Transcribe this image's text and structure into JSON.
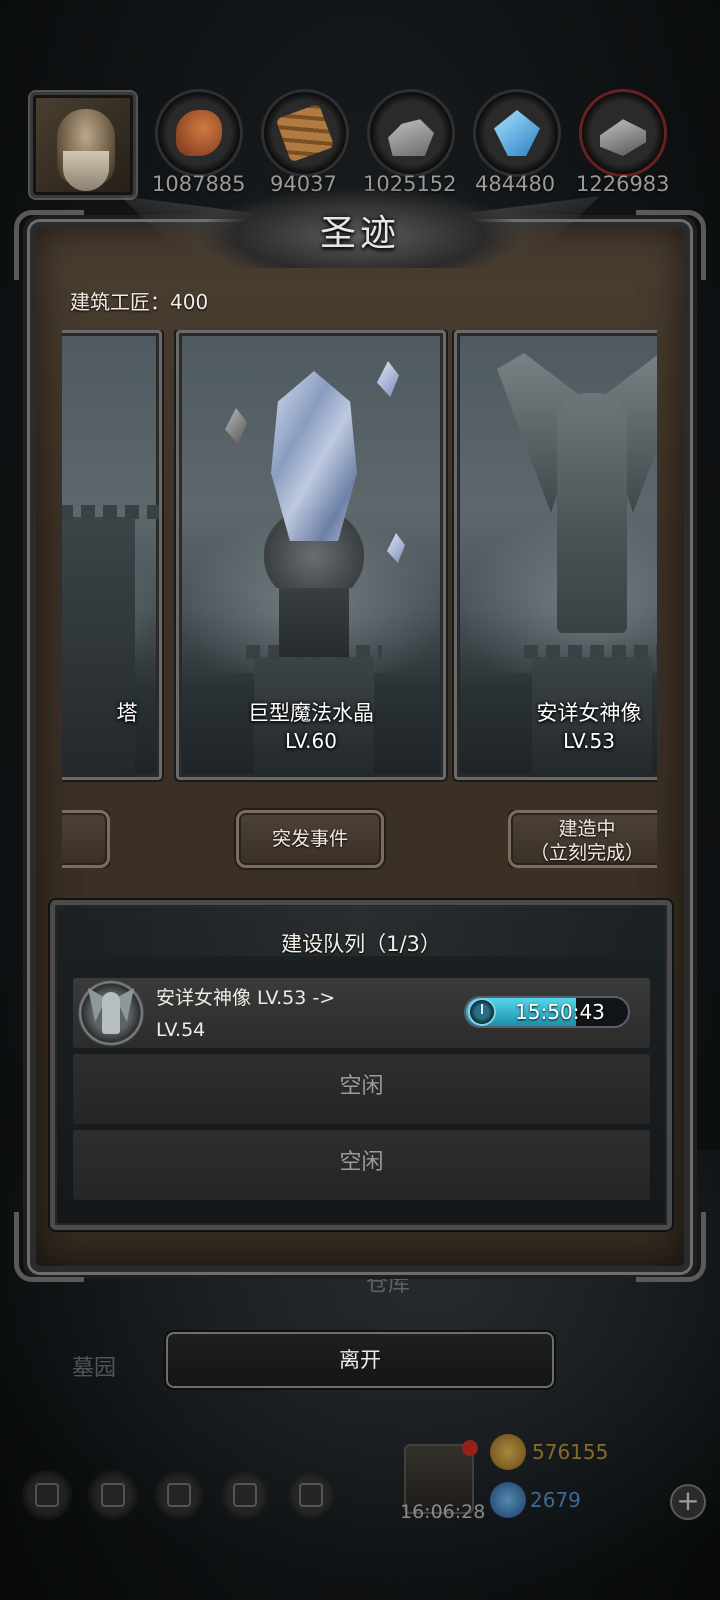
{
  "resources": [
    {
      "name": "meat-icon",
      "value": "1087885",
      "color": "#b0562a"
    },
    {
      "name": "wood-icon",
      "value": "94037",
      "color": "#9a6a36"
    },
    {
      "name": "stone-icon",
      "value": "1025152",
      "color": "#8c8c8c"
    },
    {
      "name": "crystal-icon",
      "value": "484480",
      "color": "#4fb3e8"
    },
    {
      "name": "iron-icon",
      "value": "1226983",
      "color": "#8a8a8a"
    }
  ],
  "panel": {
    "title": "圣迹",
    "craftsmen": "建筑工匠：400"
  },
  "cards": [
    {
      "name": "塔",
      "level": ""
    },
    {
      "name": "巨型魔法水晶",
      "level": "LV.60"
    },
    {
      "name": "安详女神像",
      "level": "LV.53"
    }
  ],
  "buttons": {
    "event": "突发事件",
    "building_line1": "建造中",
    "building_line2": "（立刻完成）",
    "leave": "离开"
  },
  "queue": {
    "title": "建设队列（1/3）",
    "active_line1": "安详女神像 LV.53 ->",
    "active_line2": "LV.54",
    "timer": "15:50:43",
    "timer_progress": 0.68,
    "idle1": "空闲",
    "idle2": "空闲"
  },
  "background": {
    "label_warehouse": "仓库",
    "label_cemetery": "墓园"
  },
  "bottom": {
    "gift_timer": "16:06:28",
    "gold": "576155",
    "gems": "2679",
    "gold_color": "#d4a23a",
    "gem_color": "#3b8fd6"
  }
}
